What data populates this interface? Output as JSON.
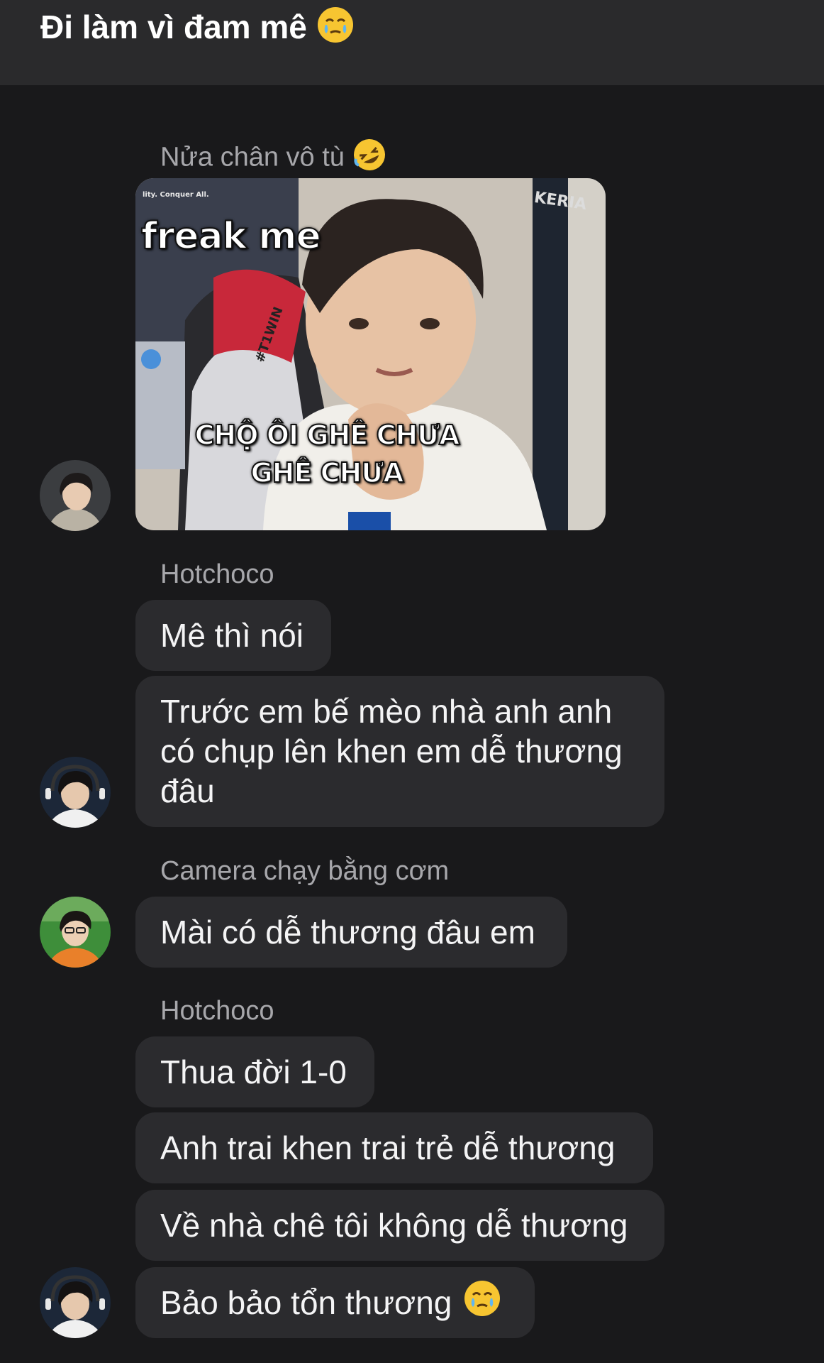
{
  "header": {
    "title": "Đi làm vì đam mê",
    "title_emoji": "face-holding-back-tears-icon"
  },
  "messages": [
    {
      "sender": "Nửa chân vô tù",
      "sender_emoji": "rolling-on-floor-laughing-icon",
      "media": {
        "caption_top": "freak me",
        "caption_bottom_1": "CHỘ ÔI GHÊ CHƯA",
        "caption_bottom_2": "GHÊ CHƯA",
        "brand_small": "lity. Conquer All.",
        "jersey_tag": "KERIA",
        "chair_tag": "#T1WIN"
      }
    },
    {
      "sender": "Hotchoco",
      "bubbles": [
        "Mê thì nói",
        "Trước em bế mèo nhà anh anh có chụp lên khen em dễ thương đâu"
      ]
    },
    {
      "sender": "Camera chạy bằng cơm",
      "bubbles": [
        "Mài có dễ thương đâu em"
      ]
    },
    {
      "sender": "Hotchoco",
      "bubbles": [
        "Thua đời 1-0",
        "Anh trai khen trai trẻ dễ thương",
        "Về nhà chê tôi không dễ thương",
        "Bảo bảo tổn thương"
      ],
      "last_bubble_emoji": "face-holding-back-tears-icon"
    }
  ],
  "colors": {
    "background": "#19191b",
    "header": "#2a2a2c",
    "bubble": "#2b2b2e",
    "sender_text": "#a7a7ab",
    "message_text": "#f4f4f5"
  }
}
